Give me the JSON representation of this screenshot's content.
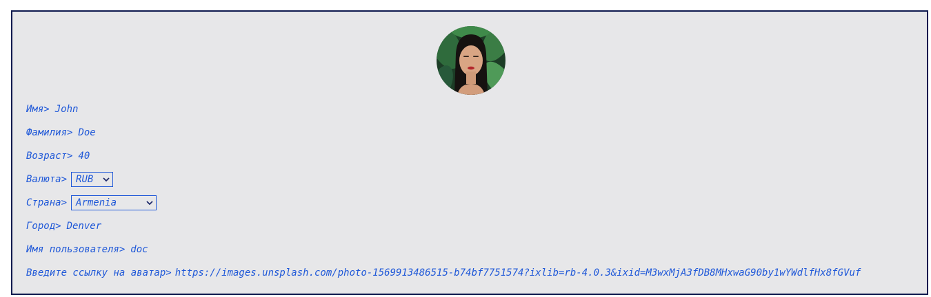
{
  "profile": {
    "avatar_alt": "avatar",
    "fields": {
      "first_name": {
        "label": "Имя>",
        "value": "John"
      },
      "last_name": {
        "label": "Фамилия>",
        "value": "Doe"
      },
      "age": {
        "label": "Возраст>",
        "value": "40"
      },
      "currency": {
        "label": "Валюта>",
        "selected": "RUB"
      },
      "country": {
        "label": "Страна>",
        "selected": "Armenia"
      },
      "city": {
        "label": "Город>",
        "value": "Denver"
      },
      "username": {
        "label": "Имя пользователя>",
        "value": "doc"
      },
      "avatar_url": {
        "label": "Введите ссылку на аватар>",
        "value": "https://images.unsplash.com/photo-1569913486515-b74bf7751574?ixlib=rb-4.0.3&ixid=M3wxMjA3fDB8MHxwaG90by1wYWdlfHx8fGVuf"
      }
    }
  },
  "icons": {
    "dropdown": "chevron-down-icon"
  },
  "colors": {
    "text": "#1f58d8",
    "card_background": "#e7e7e9",
    "card_border": "#0f1a4f"
  }
}
